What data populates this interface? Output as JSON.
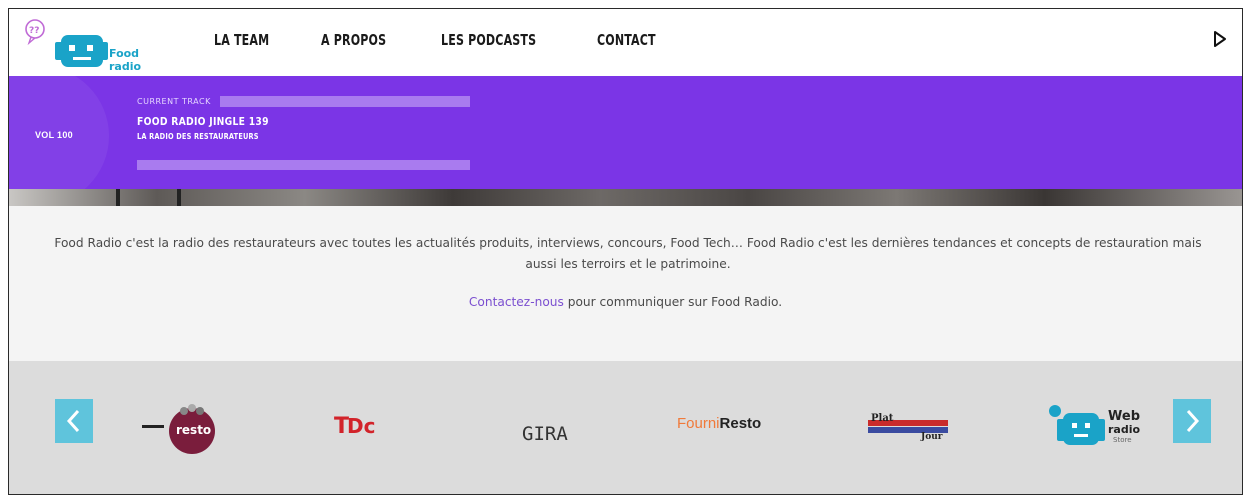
{
  "brand": {
    "logo_text": "Food radio"
  },
  "nav": [
    {
      "label": "LA TEAM"
    },
    {
      "label": "A PROPOS"
    },
    {
      "label": "LES PODCASTS"
    },
    {
      "label": "CONTACT"
    }
  ],
  "player": {
    "volume_label": "VOL 100",
    "current_track_label": "CURRENT TRACK",
    "track_title": "FOOD RADIO JINGLE 139",
    "track_subtitle": "LA RADIO DES RESTAURATEURS"
  },
  "about": {
    "description": "Food Radio c'est la radio des restaurateurs avec toutes les actualités produits, interviews, concours, Food Tech… Food Radio c'est les dernières tendances et concepts de restauration mais aussi les terroirs et le patrimoine.",
    "contact_link": "Contactez-nous",
    "contact_rest": " pour communiquer sur Food Radio."
  },
  "partners": [
    {
      "name": "resto",
      "label": "resto"
    },
    {
      "name": "DC",
      "label": "Dc"
    },
    {
      "name": "GIRA",
      "label": "GIRA"
    },
    {
      "name": "FourniResto",
      "label_a": "Fourni",
      "label_b": "Resto"
    },
    {
      "name": "Plat du Jour",
      "label_a": "Plat",
      "label_b": "Jour"
    },
    {
      "name": "Web radio Store",
      "label_a": "Web",
      "label_b": "radio",
      "label_c": "Store"
    }
  ],
  "colors": {
    "purple": "#7b35e6",
    "accent_blue": "#5fc4dc",
    "link": "#7b4fd0"
  }
}
